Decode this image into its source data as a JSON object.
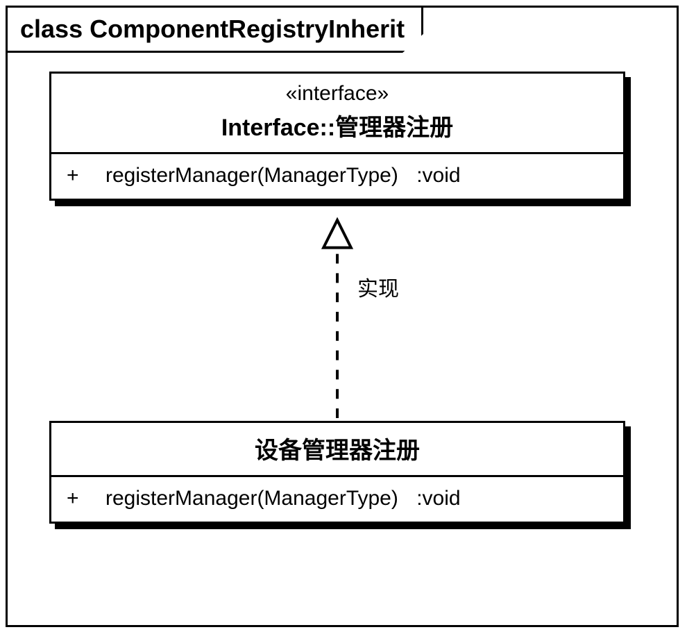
{
  "diagram": {
    "frame_title": "class ComponentRegistryInherit",
    "relationship_label": "实现",
    "interface_box": {
      "stereotype": "«interface»",
      "name": "Interface::管理器注册",
      "method": {
        "visibility": "+",
        "signature": "registerManager(ManagerType)",
        "return": ":void"
      }
    },
    "impl_box": {
      "name": "设备管理器注册",
      "method": {
        "visibility": "+",
        "signature": "registerManager(ManagerType)",
        "return": ":void"
      }
    }
  }
}
